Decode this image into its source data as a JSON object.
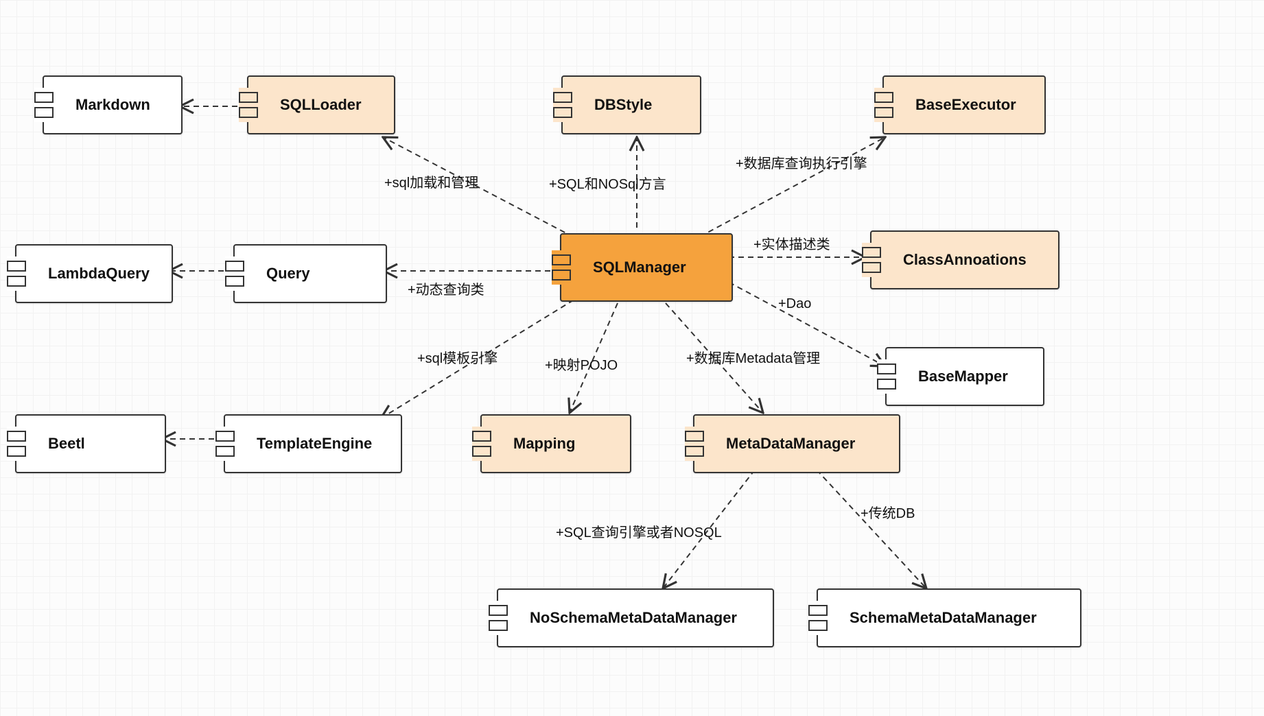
{
  "diagram": {
    "type": "uml-component",
    "nodes": {
      "markdown": {
        "label": "Markdown"
      },
      "sqlloader": {
        "label": "SQLLoader"
      },
      "dbstyle": {
        "label": "DBStyle"
      },
      "baseexec": {
        "label": "BaseExecutor"
      },
      "sqlmanager": {
        "label": "SQLManager"
      },
      "classann": {
        "label": "ClassAnnoations"
      },
      "lambdaq": {
        "label": "LambdaQuery"
      },
      "query": {
        "label": "Query"
      },
      "basemapper": {
        "label": "BaseMapper"
      },
      "beetl": {
        "label": "Beetl"
      },
      "tmpleng": {
        "label": "TemplateEngine"
      },
      "mapping": {
        "label": "Mapping"
      },
      "metadata": {
        "label": "MetaDataManager"
      },
      "noschema": {
        "label": "NoSchemaMetaDataManager"
      },
      "schema": {
        "label": "SchemaMetaDataManager"
      }
    },
    "edge_labels": {
      "sqlload": "+sql加载和管理",
      "dialect": "+SQL和NOSql方言",
      "execeng": "+数据库查询执行引擎",
      "entity": "+实体描述类",
      "dao": "+Dao",
      "dynquery": "+动态查询类",
      "tmpl": "+sql模板引擎",
      "mappojo": "+映射POJO",
      "metamgmt": "+数据库Metadata管理",
      "nosql": "+SQL查询引擎或者NOSQL",
      "tradb": "+传统DB"
    }
  }
}
